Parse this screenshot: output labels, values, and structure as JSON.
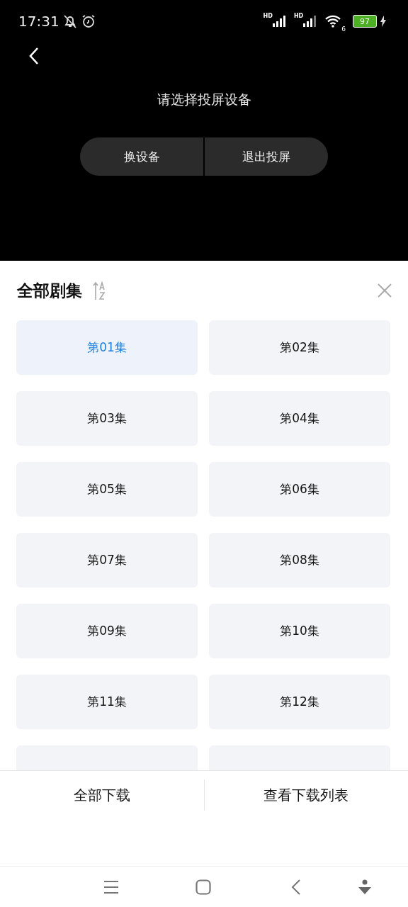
{
  "status_bar": {
    "time": "17:31",
    "signals": [
      {
        "label": "HD"
      },
      {
        "label": "HD"
      }
    ],
    "wifi_label": "6",
    "battery": "97"
  },
  "cast": {
    "prompt": "请选择投屏设备",
    "buttons": [
      "换设备",
      "退出投屏"
    ]
  },
  "sheet": {
    "title": "全部剧集",
    "episodes": [
      {
        "label": "第01集",
        "selected": true
      },
      {
        "label": "第02集",
        "selected": false
      },
      {
        "label": "第03集",
        "selected": false
      },
      {
        "label": "第04集",
        "selected": false
      },
      {
        "label": "第05集",
        "selected": false
      },
      {
        "label": "第06集",
        "selected": false
      },
      {
        "label": "第07集",
        "selected": false
      },
      {
        "label": "第08集",
        "selected": false
      },
      {
        "label": "第09集",
        "selected": false
      },
      {
        "label": "第10集",
        "selected": false
      },
      {
        "label": "第11集",
        "selected": false
      },
      {
        "label": "第12集",
        "selected": false
      }
    ],
    "actions": [
      "全部下载",
      "查看下载列表"
    ]
  }
}
